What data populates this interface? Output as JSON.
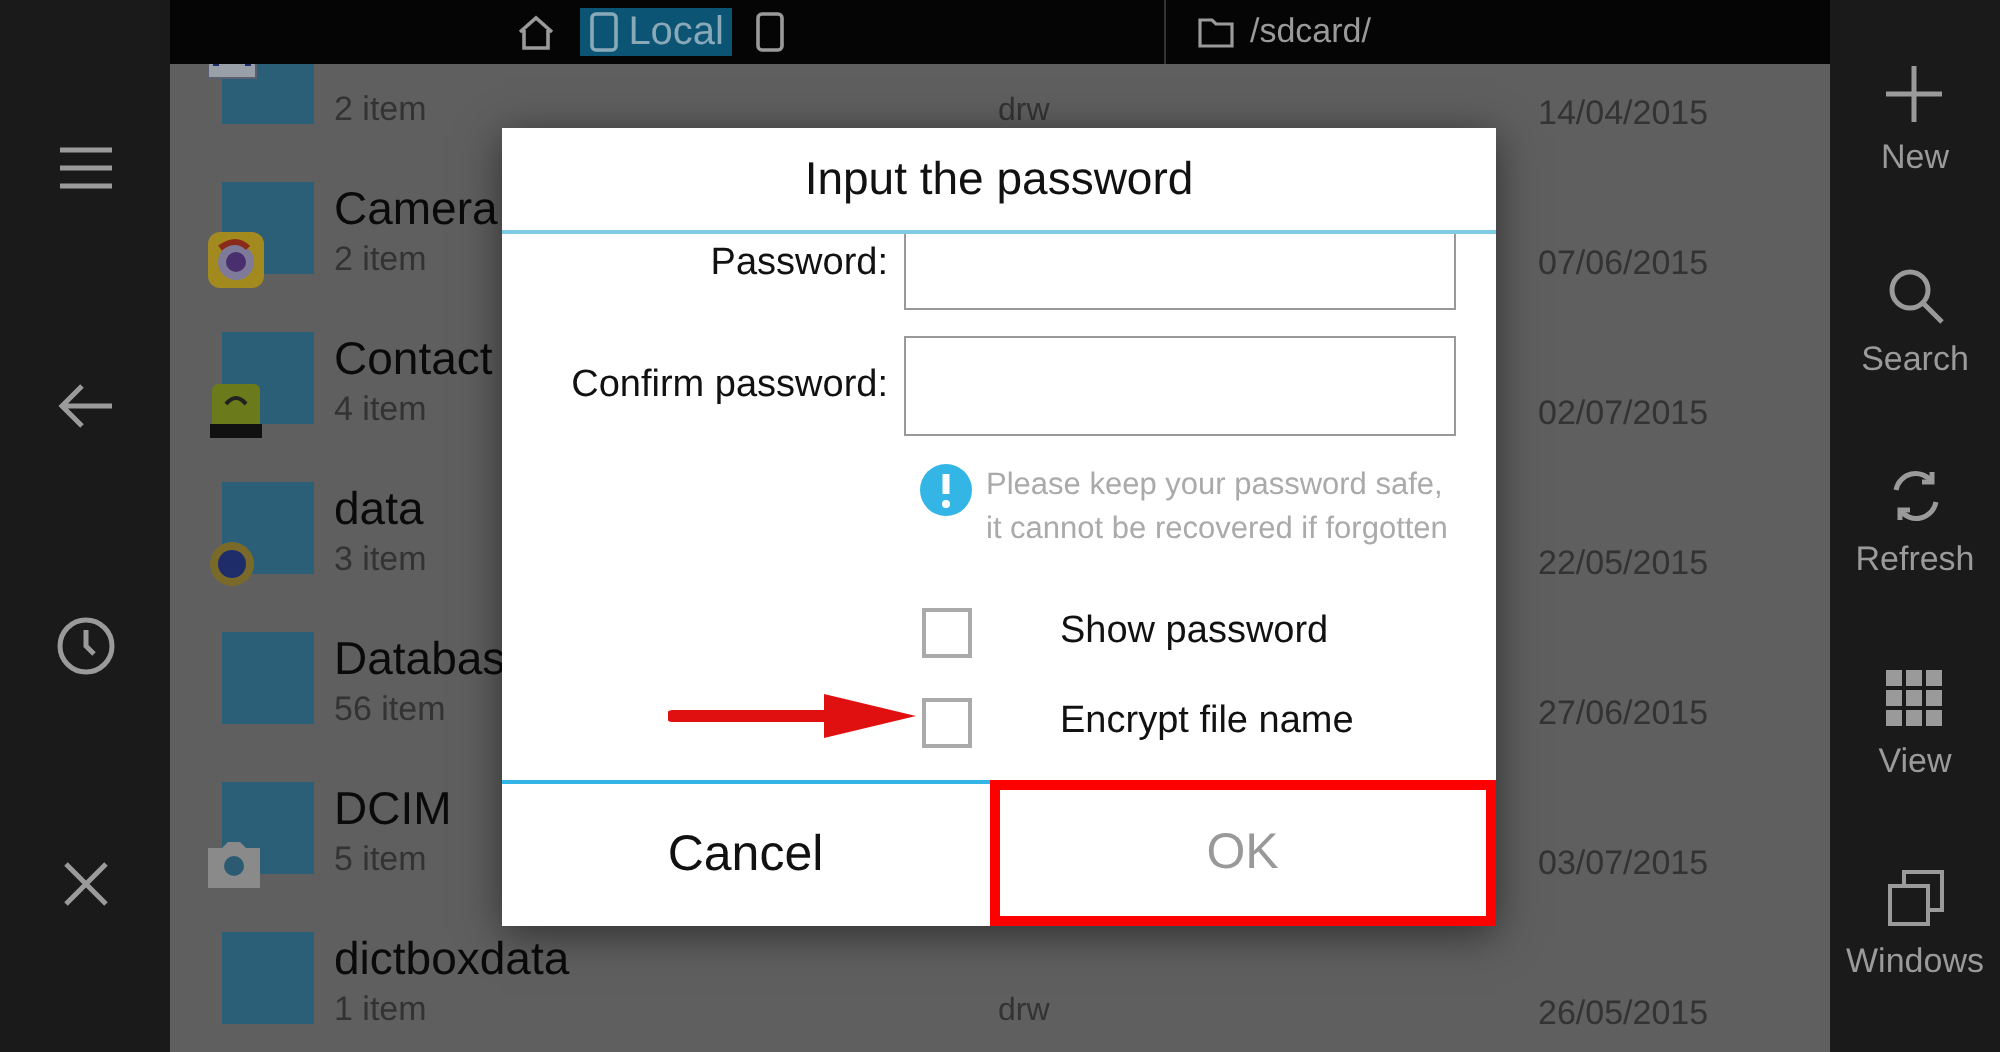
{
  "top_bar": {
    "location": {
      "label": "Local",
      "selected": true
    },
    "path": "/sdcard/"
  },
  "right_toolbar": [
    {
      "label": "New",
      "kind": "plus"
    },
    {
      "label": "Search",
      "kind": "search"
    },
    {
      "label": "Refresh",
      "kind": "refresh"
    },
    {
      "label": "View",
      "kind": "grid"
    },
    {
      "label": "Windows",
      "kind": "windows"
    }
  ],
  "files": [
    {
      "count": "2 item",
      "permissions": "drw",
      "date": "14/04/2015"
    },
    {
      "name": "Camera",
      "count": "2 item",
      "date": "07/06/2015"
    },
    {
      "name": "Contact",
      "count": "4 item",
      "date": "02/07/2015"
    },
    {
      "name": "data",
      "count": "3 item",
      "date": "22/05/2015"
    },
    {
      "name": "Databas",
      "count": "56 item",
      "date": "27/06/2015"
    },
    {
      "name": "DCIM",
      "count": "5 item",
      "date": "03/07/2015"
    },
    {
      "name": "dictboxdata",
      "count": "1 item",
      "permissions": "drw",
      "date": "26/05/2015"
    }
  ],
  "dialog": {
    "title": "Input the password",
    "fields": [
      {
        "label": "Password:"
      },
      {
        "label": "Confirm password:"
      }
    ],
    "note": "Please keep your password safe, it cannot be recovered if forgotten",
    "options": [
      {
        "label": "Show password",
        "checked": false
      },
      {
        "label": "Encrypt file name",
        "checked": false
      }
    ],
    "buttons": [
      {
        "label": "Cancel",
        "disabled": false,
        "highlighted": false
      },
      {
        "label": "OK",
        "disabled": true,
        "highlighted": true
      }
    ]
  }
}
